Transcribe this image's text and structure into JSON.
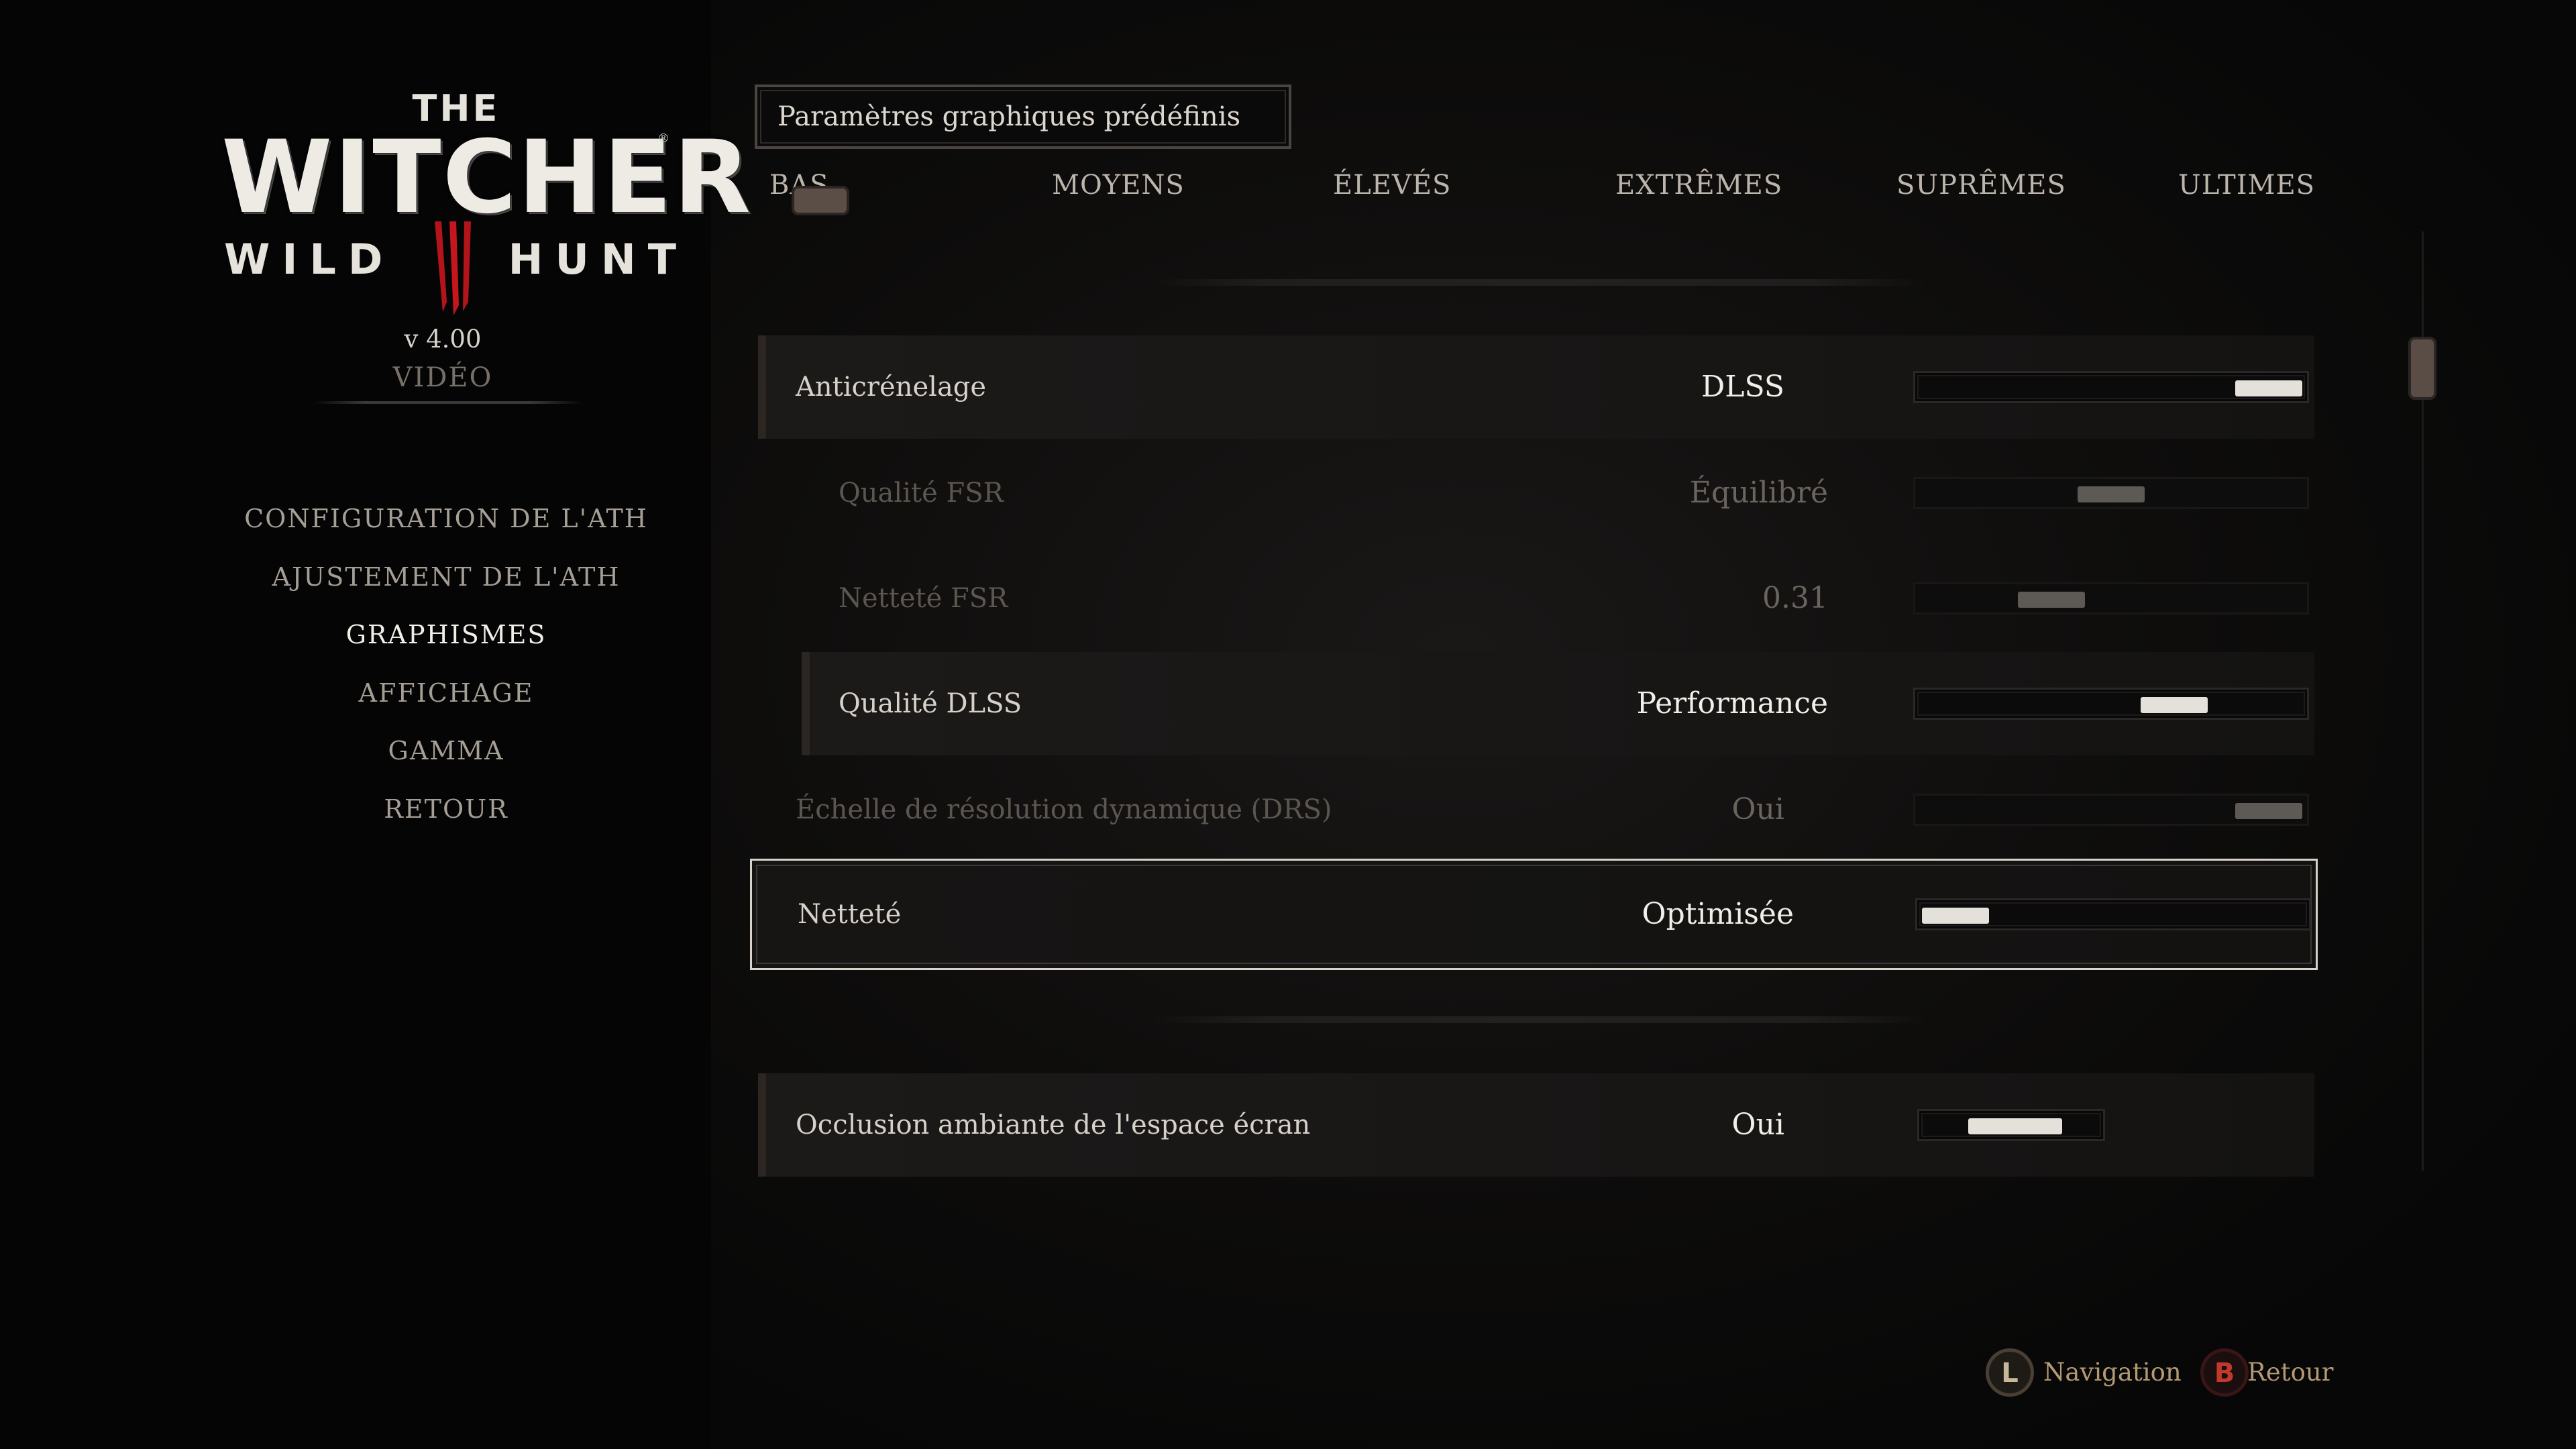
{
  "sidebar": {
    "logo": {
      "the": "THE",
      "title": "WITCHER",
      "subtitle_left": "WILD",
      "subtitle_right": "HUNT",
      "numeral": "III",
      "reg": "®"
    },
    "version": "v 4.00",
    "section": "VIDÉO",
    "menu": [
      {
        "label": "CONFIGURATION DE L'ATH"
      },
      {
        "label": "AJUSTEMENT DE L'ATH"
      },
      {
        "label": "GRAPHISMES",
        "active": true
      },
      {
        "label": "AFFICHAGE"
      },
      {
        "label": "GAMMA"
      },
      {
        "label": "RETOUR"
      }
    ]
  },
  "presets": {
    "title": "Paramètres graphiques prédéfinis",
    "options": [
      "BAS",
      "MOYENS",
      "ÉLEVÉS",
      "EXTRÊMES",
      "SUPRÊMES",
      "ULTIMES"
    ],
    "selected": "BAS"
  },
  "settings": [
    {
      "label": "Anticrénelage",
      "value": "DLSS",
      "level": 1.0
    },
    {
      "label": "Qualité FSR",
      "value": "Équilibré",
      "level": 0.5
    },
    {
      "label": "Netteté FSR",
      "value": "0.31",
      "level": 0.31
    },
    {
      "label": "Qualité DLSS",
      "value": "Performance",
      "level": 0.7
    },
    {
      "label": "Échelle de résolution dynamique (DRS)",
      "value": "Oui",
      "level": 1.0
    },
    {
      "label": "Netteté",
      "value": "Optimisée",
      "level": 0.0
    },
    {
      "label": "Occlusion ambiante de l'espace écran",
      "value": "Oui",
      "level": 0.55
    }
  ],
  "footer": {
    "navigation_key": "L",
    "navigation_label": "Navigation",
    "back_key": "B",
    "back_label": "Retour"
  },
  "colors": {
    "accent": "#e4e0da",
    "button_b": "#c0392b",
    "hint_text": "#b49a73",
    "preset_thumb": "#5a4e46"
  }
}
